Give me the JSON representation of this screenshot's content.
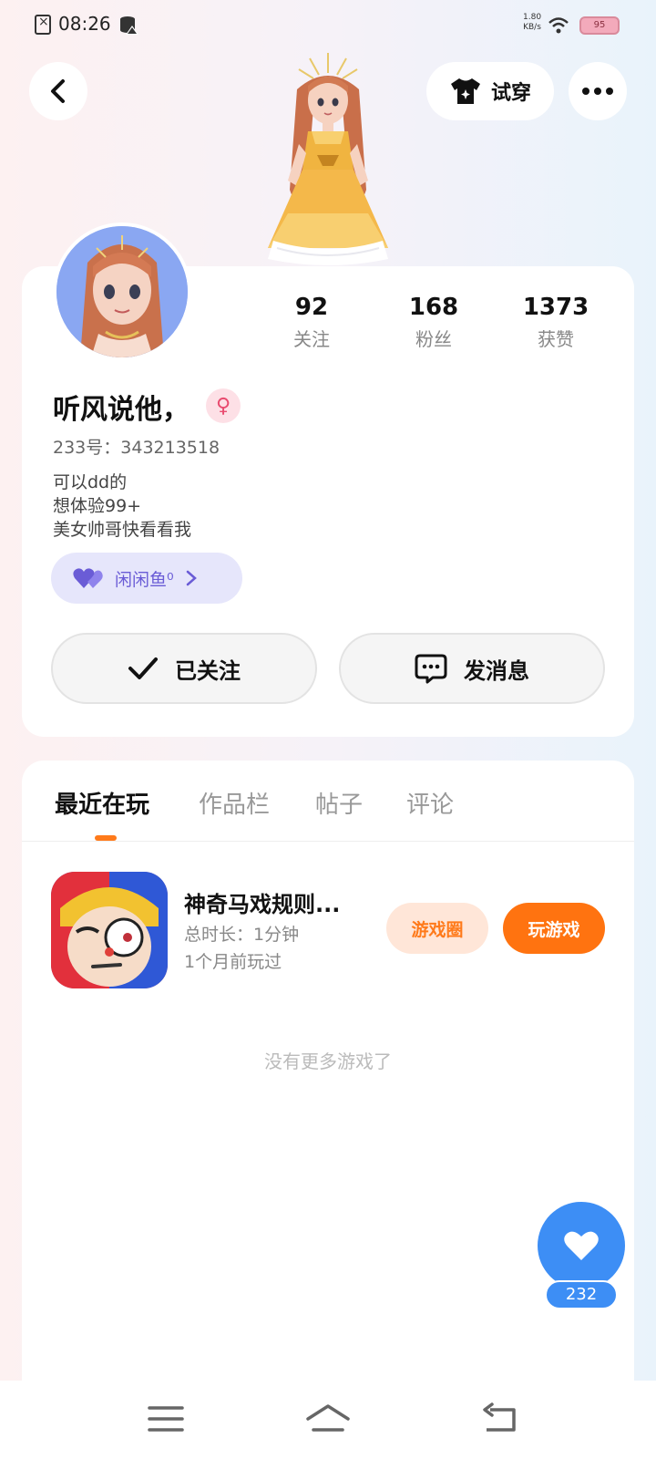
{
  "status_bar": {
    "time": "08:26",
    "net_speed": "1.80\nKB/s",
    "net_speed_value": "1.80",
    "net_speed_unit": "KB/s",
    "battery": "95"
  },
  "header": {
    "tryon_label": "试穿"
  },
  "profile": {
    "stats": [
      {
        "num": "92",
        "label": "关注"
      },
      {
        "num": "168",
        "label": "粉丝"
      },
      {
        "num": "1373",
        "label": "获赞"
      }
    ],
    "nickname": "听风说他，",
    "gender_symbol": "♀",
    "uid": "233号：343213518",
    "bio": [
      "可以dd的",
      "想体验99+",
      "美女帅哥快看看我"
    ],
    "fan_chip_label": "闲闲鱼⁰",
    "follow_label": "已关注",
    "message_label": "发消息"
  },
  "tabs": [
    {
      "label": "最近在玩",
      "active": true
    },
    {
      "label": "作品栏",
      "active": false
    },
    {
      "label": "帖子",
      "active": false
    },
    {
      "label": "评论",
      "active": false
    }
  ],
  "game": {
    "title": "神奇马戏规则...",
    "duration": "总时长：1分钟",
    "last_played": "1个月前玩过",
    "circle_label": "游戏圈",
    "play_label": "玩游戏"
  },
  "no_more_text": "没有更多游戏了",
  "like_count": "232",
  "colors": {
    "accent": "#ff7310",
    "like_blue": "#3d8ef5",
    "chip_purple": "#6a5cd6"
  }
}
